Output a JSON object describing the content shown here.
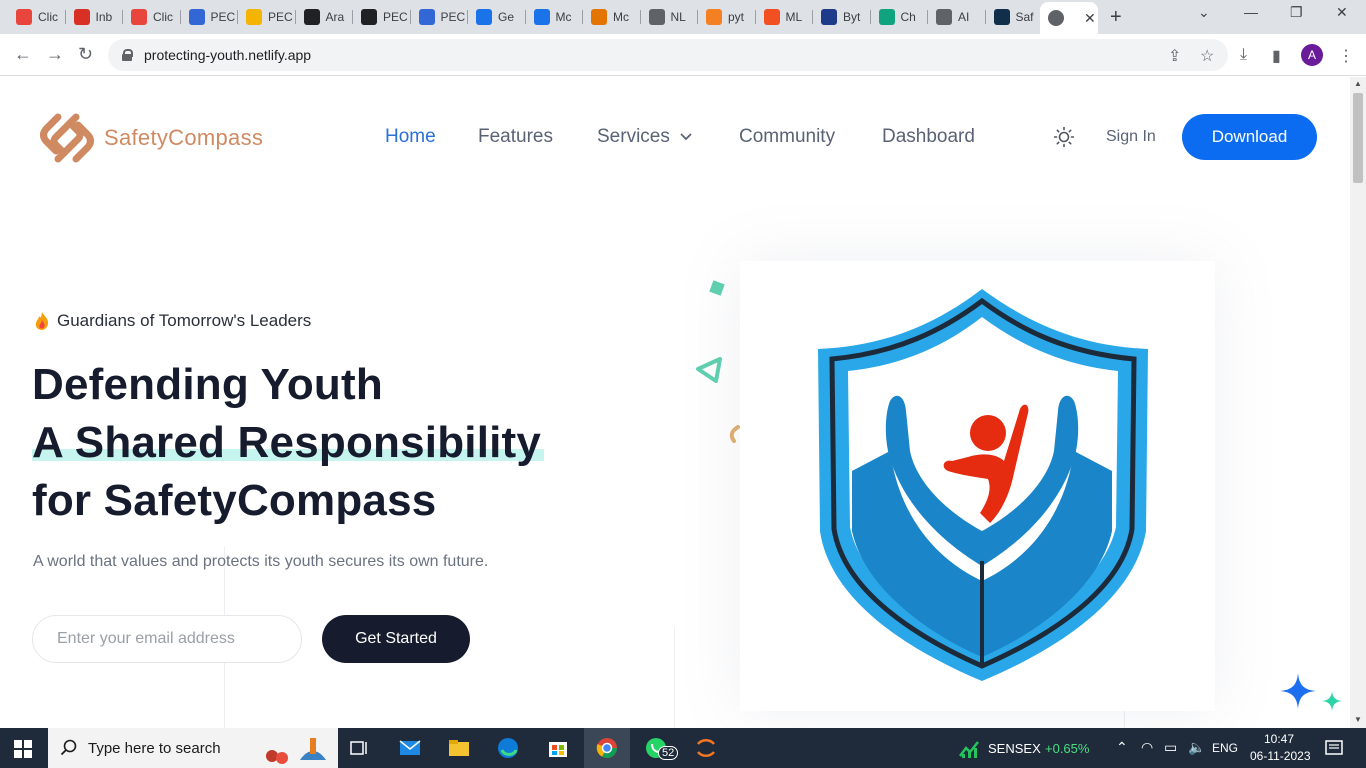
{
  "browser": {
    "tabs": [
      {
        "label": "Clic",
        "icon": "clickup-icon",
        "color": "#e8453c"
      },
      {
        "label": "Inb",
        "icon": "gmail-icon",
        "color": "#d93025"
      },
      {
        "label": "Clic",
        "icon": "clickup-icon",
        "color": "#e8453c"
      },
      {
        "label": "PEC",
        "icon": "docs-icon",
        "color": "#3367d6"
      },
      {
        "label": "PEC",
        "icon": "slides-icon",
        "color": "#f4b400"
      },
      {
        "label": "Ara",
        "icon": "github-icon",
        "color": "#202124"
      },
      {
        "label": "PEC",
        "icon": "pec-icon",
        "color": "#202124"
      },
      {
        "label": "PEC",
        "icon": "docs-icon",
        "color": "#3367d6"
      },
      {
        "label": "Ge",
        "icon": "k-icon",
        "color": "#1a73e8"
      },
      {
        "label": "Mc",
        "icon": "k-icon",
        "color": "#1a73e8"
      },
      {
        "label": "Mc",
        "icon": "book-icon",
        "color": "#e37400"
      },
      {
        "label": "NL",
        "icon": "globe-icon",
        "color": "#5f6368"
      },
      {
        "label": "pyt",
        "icon": "stackoverflow-icon",
        "color": "#f48024"
      },
      {
        "label": "ML",
        "icon": "ring-icon",
        "color": "#f25022"
      },
      {
        "label": "Byt",
        "icon": "un-icon",
        "color": "#1e3a8a"
      },
      {
        "label": "Ch",
        "icon": "chatgpt-icon",
        "color": "#10a37f"
      },
      {
        "label": "AI",
        "icon": "bot-icon",
        "color": "#5f6368"
      },
      {
        "label": "Saf",
        "icon": "d-icon",
        "color": "#0f2f4a"
      }
    ],
    "active_tab_close": "✕",
    "new_tab": "+",
    "url": "protecting-youth.netlify.app",
    "profile_initial": "A"
  },
  "site": {
    "logo_text": "SafetyCompass",
    "nav": {
      "home": "Home",
      "features": "Features",
      "services": "Services",
      "community": "Community",
      "dashboard": "Dashboard"
    },
    "signin": "Sign In",
    "download": "Download",
    "tagline": "Guardians of Tomorrow's Leaders",
    "headline": [
      "Defending Youth",
      "A Shared Responsibility",
      "for SafetyCompass"
    ],
    "subtext": "A world that values and protects its youth secures its own future.",
    "email_placeholder": "Enter your email address",
    "cta": "Get Started"
  },
  "taskbar": {
    "search_placeholder": "Type here to search",
    "whatsapp_badge": "52",
    "stock_name": "SENSEX",
    "stock_change": "+0.65%",
    "language": "ENG",
    "time": "10:47",
    "date": "06-11-2023"
  },
  "colors": {
    "accent_blue": "#0b6cf2",
    "nav_active": "#2b6fd9",
    "dark": "#161c2d",
    "logo_orange": "#d08a62",
    "highlight": "#c6f5f0"
  }
}
